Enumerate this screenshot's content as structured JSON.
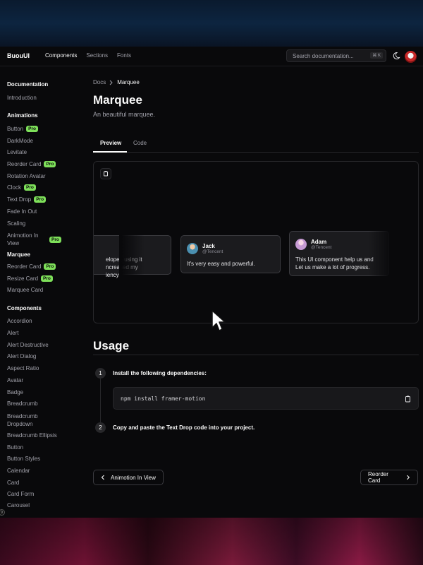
{
  "header": {
    "brand": "BuouUI",
    "nav": [
      "Components",
      "Sections",
      "Fonts"
    ],
    "search_placeholder": "Search documentation...",
    "search_shortcut": "⌘ K"
  },
  "sidebar": {
    "sections": [
      {
        "title": "Documentation",
        "items": [
          {
            "label": "Introduction"
          }
        ]
      },
      {
        "title": "Animations",
        "items": [
          {
            "label": "Button",
            "pro": "Pro"
          },
          {
            "label": "DarkMode"
          },
          {
            "label": "Levitate"
          },
          {
            "label": "Reorder Card",
            "pro": "Pro"
          },
          {
            "label": "Rotation Avatar"
          },
          {
            "label": "Clock",
            "pro": "Pro"
          },
          {
            "label": "Text Drop",
            "pro": "Pro"
          },
          {
            "label": "Fade In Out"
          },
          {
            "label": "Scaling"
          },
          {
            "label": "Animotion In View",
            "pro": "Pro"
          },
          {
            "label": "Marquee",
            "active": true
          },
          {
            "label": "Reorder Card",
            "pro": "Pro"
          },
          {
            "label": "Resize Card",
            "pro": "Pro"
          },
          {
            "label": "Marquee Card"
          }
        ]
      },
      {
        "title": "Components",
        "items": [
          {
            "label": "Accordion"
          },
          {
            "label": "Alert"
          },
          {
            "label": "Alert Destructive"
          },
          {
            "label": "Alert Dialog"
          },
          {
            "label": "Aspect Ratio"
          },
          {
            "label": "Avatar"
          },
          {
            "label": "Badge"
          },
          {
            "label": "Breadcrumb"
          },
          {
            "label": "Breadcrumb Dropdown"
          },
          {
            "label": "Breadcrumb Ellipsis"
          },
          {
            "label": "Button"
          },
          {
            "label": "Button Styles"
          },
          {
            "label": "Calendar"
          },
          {
            "label": "Card"
          },
          {
            "label": "Card Form"
          },
          {
            "label": "Carousel"
          }
        ]
      }
    ]
  },
  "main": {
    "breadcrumb": {
      "root": "Docs",
      "current": "Marquee"
    },
    "title": "Marquee",
    "subtitle": "An beautiful marquee.",
    "tabs": [
      "Preview",
      "Code"
    ],
    "marquee_cards": [
      {
        "name": "",
        "handle": "",
        "text": "eloper, using it\nncreased my\niency.."
      },
      {
        "name": "Jack",
        "handle": "@Tencent",
        "text": "It's very easy and powerful."
      },
      {
        "name": "Adam",
        "handle": "@Tencent",
        "text": "This UI component help us and Let us make a lot of progress."
      }
    ],
    "usage_title": "Usage",
    "steps": [
      {
        "num": "1",
        "text": "Install the following dependencies:"
      },
      {
        "num": "2",
        "text": "Copy and paste the Text Drop code into your project."
      }
    ],
    "code": "npm install framer-motion",
    "prev_label": "Animotion In View",
    "next_label": "Reorder Card"
  },
  "colors": {
    "accent_pro": "#7ee05a",
    "background": "#09090b"
  }
}
